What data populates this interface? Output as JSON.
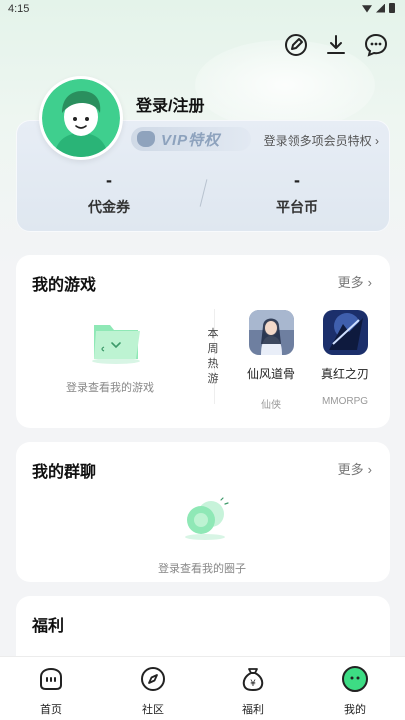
{
  "status_bar": {
    "time": "4:15"
  },
  "header": {
    "icons": [
      "edit-icon",
      "download-icon",
      "message-icon"
    ]
  },
  "profile": {
    "login_label": "登录/注册",
    "avatar_icon": "default-avatar-icon"
  },
  "vip": {
    "badge_label": "VIP特权",
    "hint": "登录领多项会员特权 ›",
    "stats": [
      {
        "value": "-",
        "label": "代金券"
      },
      {
        "value": "-",
        "label": "平台币"
      }
    ]
  },
  "my_games": {
    "title": "我的游戏",
    "more": "更多",
    "empty_text": "登录查看我的游戏",
    "weekly_hot_label": "本周热游",
    "hot_games": [
      {
        "name": "仙风道骨",
        "tag": "仙侠"
      },
      {
        "name": "真红之刃",
        "tag": "MMORPG"
      }
    ]
  },
  "my_groups": {
    "title": "我的群聊",
    "more": "更多",
    "empty_text": "登录查看我的圈子"
  },
  "welfare": {
    "title": "福利"
  },
  "tabbar": {
    "tabs": [
      {
        "label": "首页",
        "icon": "home-icon"
      },
      {
        "label": "社区",
        "icon": "compass-icon"
      },
      {
        "label": "福利",
        "icon": "money-bag-icon"
      },
      {
        "label": "我的",
        "icon": "profile-face-icon"
      }
    ]
  },
  "colors": {
    "accent": "#3ddc84",
    "page_bg": "#f3f4f6",
    "vip_text": "#8da2bd"
  }
}
